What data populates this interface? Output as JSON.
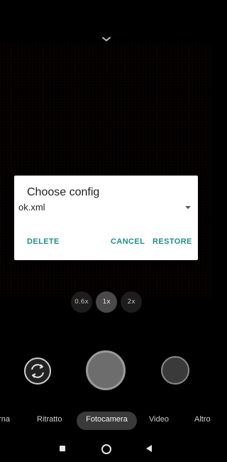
{
  "dialog": {
    "title": "Choose config",
    "selected_config": "ok.xml",
    "buttons": {
      "delete": "DELETE",
      "cancel": "CANCEL",
      "restore": "RESTORE"
    },
    "accent_color": "#1f8f86"
  },
  "zoom": {
    "options": [
      "0.6x",
      "1x",
      "2x"
    ],
    "selected": "1x"
  },
  "modes": {
    "items": [
      "urna",
      "Ritratto",
      "Fotocamera",
      "Video",
      "Altro"
    ],
    "active": "Fotocamera"
  },
  "icons": {
    "top": "chevron-down-icon",
    "switch_camera": "switch-camera-icon",
    "nav_recents": "recents-square-icon",
    "nav_home": "home-circle-icon",
    "nav_back": "back-triangle-icon"
  }
}
